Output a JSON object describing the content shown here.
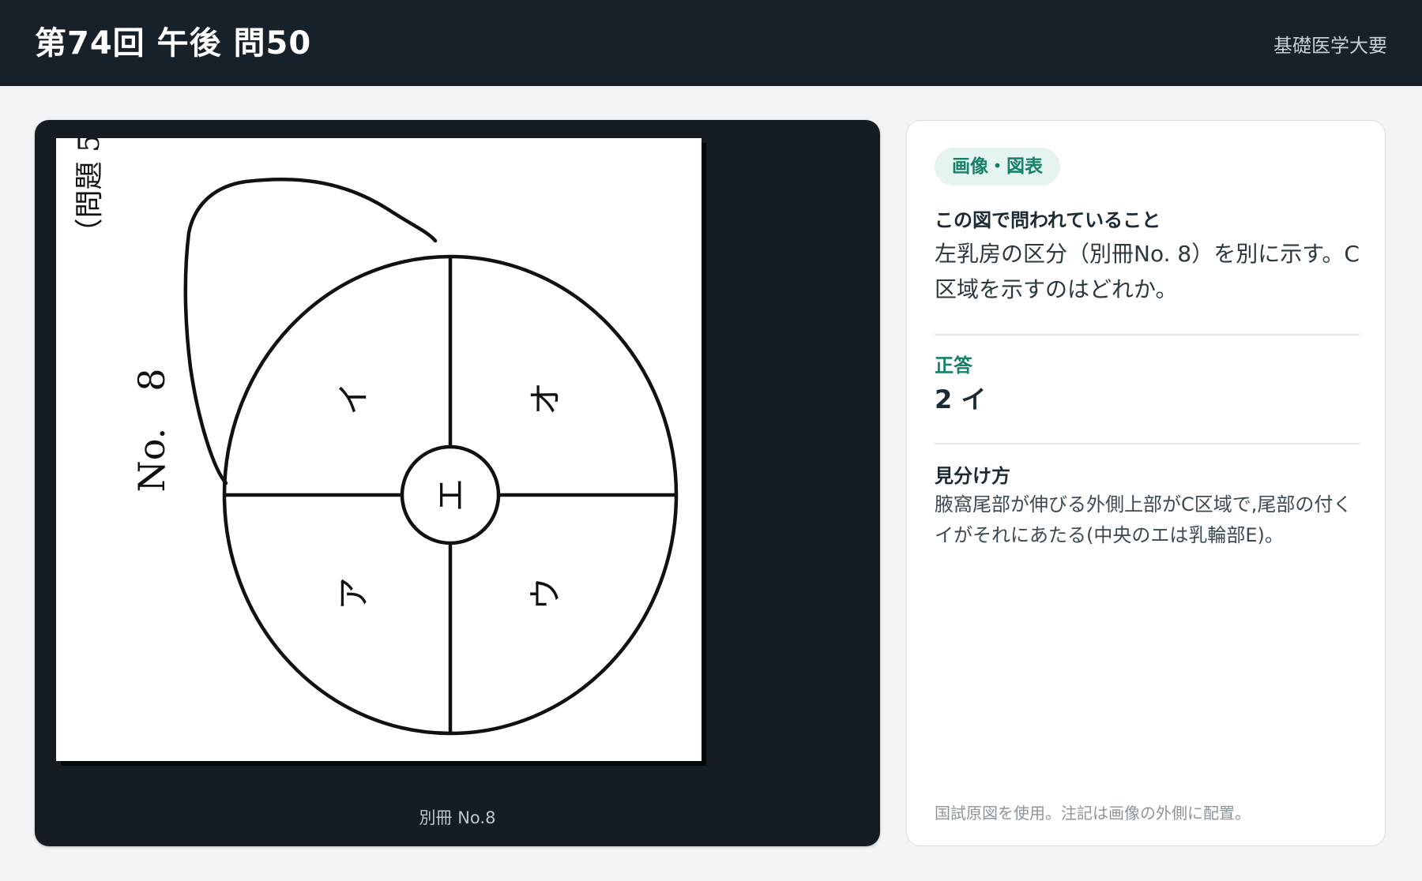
{
  "header": {
    "title": "第74回 午後 問50",
    "subject": "基礎医学大要"
  },
  "figure": {
    "caption": "別冊 No.8",
    "sheet_label": "No.　8",
    "sheet_top_label": "（問題 5",
    "regions": {
      "upper_left": "イ",
      "upper_right": "オ",
      "lower_left": "ア",
      "lower_right": "ウ",
      "center": "エ"
    }
  },
  "info": {
    "badge": "画像・図表",
    "question_heading": "この図で問われていること",
    "question_text": "左乳房の区分（別冊No. 8）を別に示す。C 区域を示すのはどれか。",
    "answer_label": "正答",
    "answer_value": "2 イ",
    "how_heading": "見分け方",
    "how_text": "腋窩尾部が伸びる外側上部がC区域で,尾部の付くイがそれにあたる(中央のエは乳輪部E)。",
    "note": "国試原図を使用。注記は画像の外側に配置。"
  }
}
